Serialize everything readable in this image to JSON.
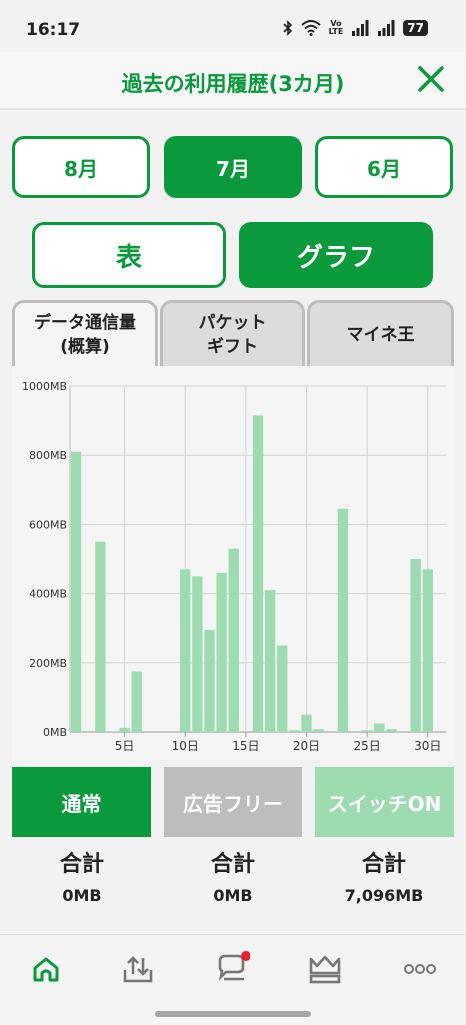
{
  "status": {
    "time": "16:17",
    "volte": "Vo\nLTE",
    "battery": "77"
  },
  "header": {
    "title": "過去の利用履歴(3カ月)"
  },
  "months": [
    "8月",
    "7月",
    "6月"
  ],
  "views": {
    "table": "表",
    "graph": "グラフ"
  },
  "tabs": [
    {
      "line1": "データ通信量",
      "line2": "(概算)"
    },
    {
      "line1": "パケット",
      "line2": "ギフト"
    },
    {
      "line1": "マイネ王",
      "line2": ""
    }
  ],
  "colors": {
    "accent": "#0a9a3c",
    "bar": "#9ddbb0",
    "gray": "#bdbdbd"
  },
  "chart_data": {
    "type": "bar",
    "ylabel_unit": "MB",
    "ylim": [
      0,
      1000
    ],
    "y_ticks": [
      "0MB",
      "200MB",
      "400MB",
      "600MB",
      "800MB",
      "1000MB"
    ],
    "x_ticks": [
      "5日",
      "10日",
      "15日",
      "20日",
      "25日",
      "30日"
    ],
    "days": [
      1,
      2,
      3,
      4,
      5,
      6,
      7,
      8,
      9,
      10,
      11,
      12,
      13,
      14,
      15,
      16,
      17,
      18,
      19,
      20,
      21,
      22,
      23,
      24,
      25,
      26,
      27,
      28,
      29,
      30,
      31
    ],
    "values": [
      810,
      3,
      550,
      2,
      12,
      175,
      0,
      0,
      0,
      470,
      450,
      295,
      460,
      530,
      0,
      915,
      410,
      250,
      5,
      50,
      8,
      0,
      645,
      0,
      5,
      25,
      8,
      0,
      500,
      470,
      0
    ],
    "grid": true
  },
  "legend": [
    {
      "label": "通常",
      "color": "#0a9a3c"
    },
    {
      "label": "広告フリー",
      "color": "#bdbdbd"
    },
    {
      "label": "スイッチON",
      "color": "#9ddbb0"
    }
  ],
  "totals": {
    "label": "合計",
    "values": [
      "0MB",
      "0MB",
      "7,096MB"
    ]
  },
  "nav": [
    "home-icon",
    "data-share-icon",
    "community-icon",
    "crown-icon",
    "more-icon"
  ]
}
